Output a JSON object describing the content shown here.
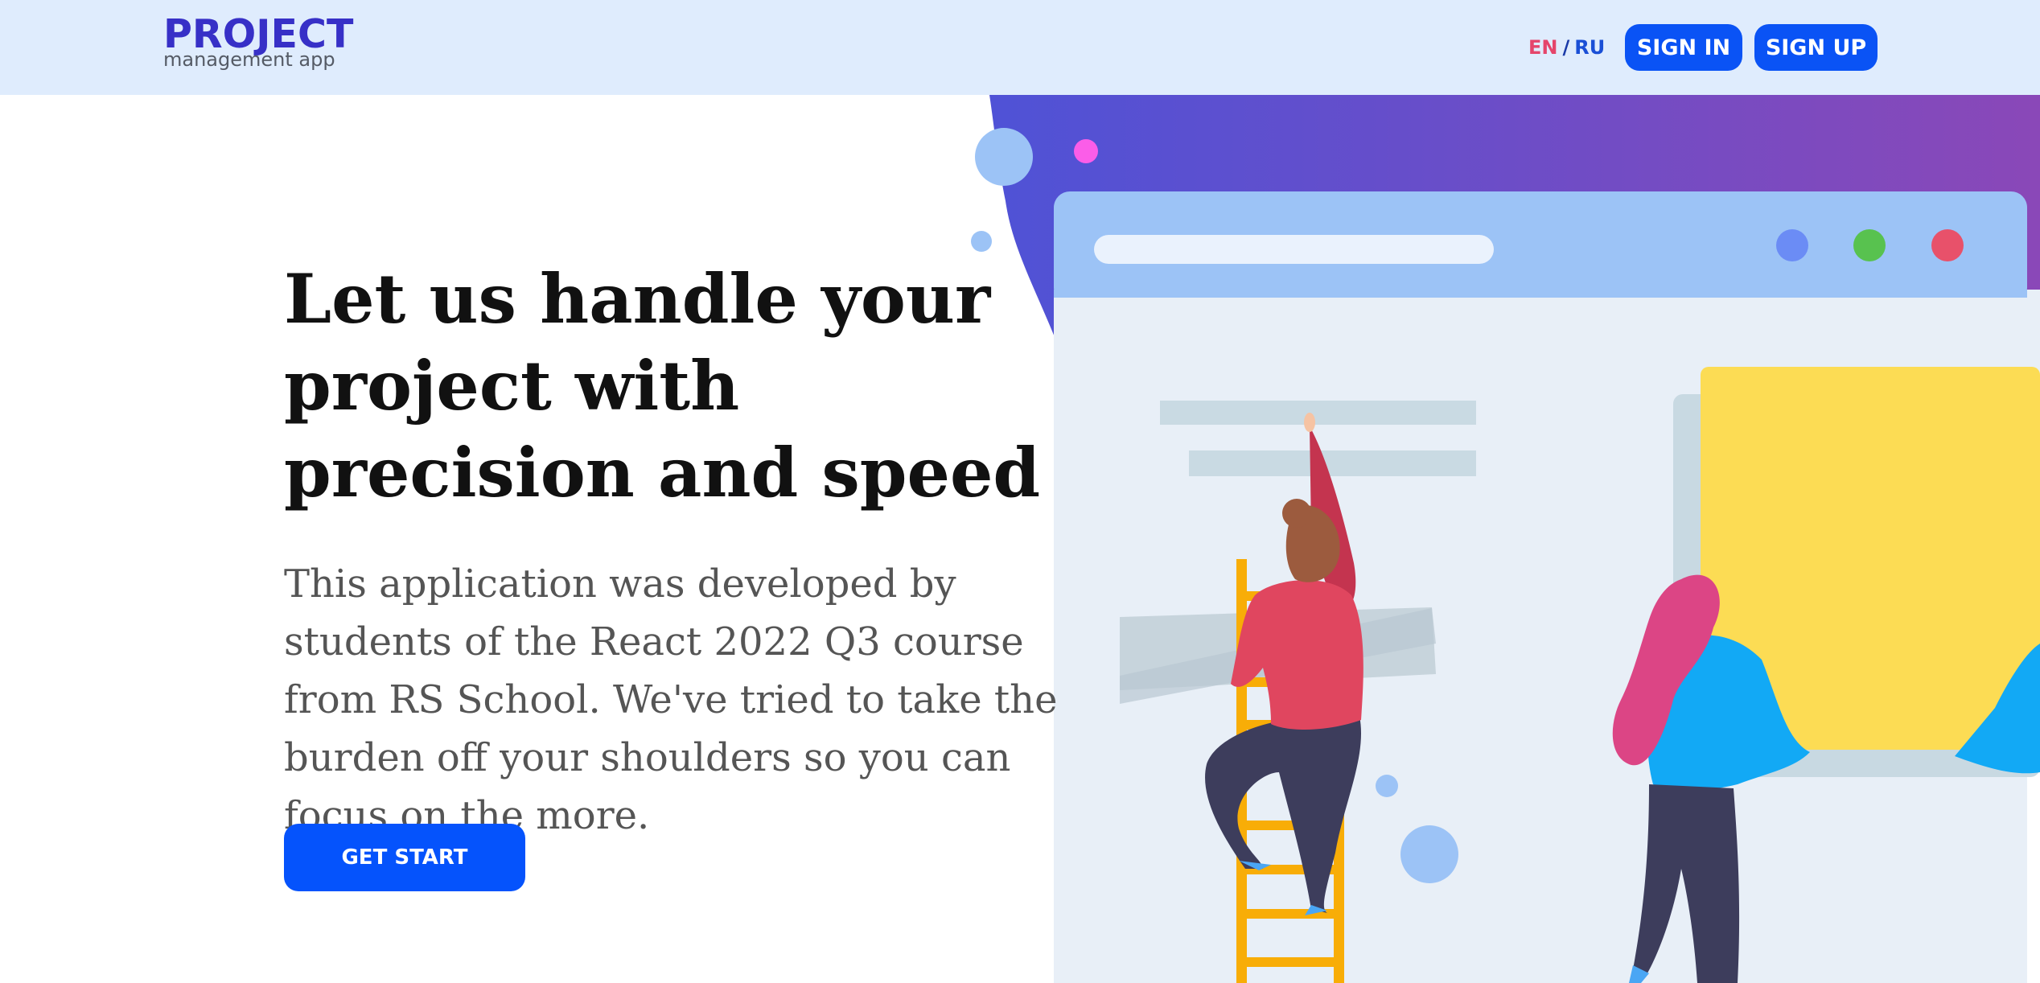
{
  "header": {
    "logo_title": "PROJECT",
    "logo_subtitle": "management app",
    "lang_en": "EN",
    "lang_sep": "/",
    "lang_ru": "RU",
    "sign_in": "SIGN IN",
    "sign_up": "SIGN UP"
  },
  "hero": {
    "title": "Let us handle your project with precision and speed",
    "description": "This application was developed by students of the React 2022 Q3 course from RS School. We've tried to take the burden off your shoulders so you can focus on the more.",
    "cta": "GET START"
  },
  "colors": {
    "accent": "#0553fc",
    "brand": "#3730c7",
    "header_bg": "#dfecfd",
    "active_lang": "#e5456b"
  }
}
